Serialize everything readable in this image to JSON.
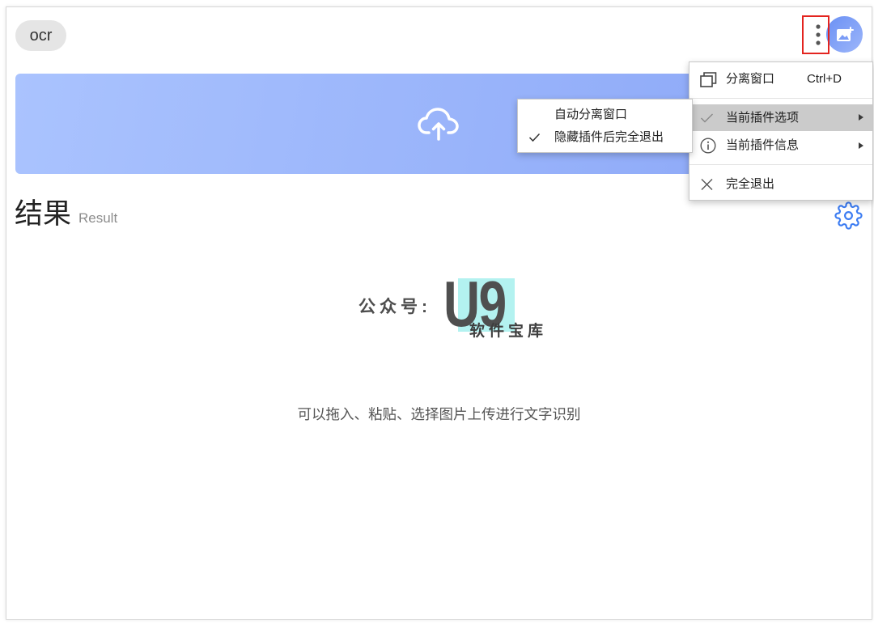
{
  "window": {
    "plugin_tag": "ocr"
  },
  "header": {
    "more_icon": "more-vertical-icon",
    "avatar_icon": "image-icon"
  },
  "upload": {
    "icon": "cloud-upload-icon"
  },
  "result": {
    "title": "结果",
    "subtitle": "Result",
    "settings_icon": "gear-icon",
    "placeholder": "可以拖入、粘贴、选择图片上传进行文字识别"
  },
  "watermark": {
    "prefix": "公众号:",
    "brand": "U9",
    "tagline": "软件宝库"
  },
  "context_menu": {
    "items": [
      {
        "label": "分离窗口",
        "shortcut": "Ctrl+D",
        "icon": "detach-window-icon"
      },
      {
        "label": "当前插件选项",
        "icon": "check-icon",
        "submenu": true,
        "highlighted": true
      },
      {
        "label": "当前插件信息",
        "icon": "info-icon",
        "submenu": true,
        "highlighted": false
      },
      {
        "label": "完全退出",
        "icon": "close-icon"
      }
    ]
  },
  "submenu": {
    "items": [
      {
        "label": "自动分离窗口",
        "checked": false
      },
      {
        "label": "隐藏插件后完全退出",
        "checked": true
      }
    ]
  },
  "colors": {
    "accent": "#3c7cf2",
    "upload-start": "#aac3fe",
    "upload-end": "#8aa6f7",
    "highlight": "#cbcbcb",
    "annotation": "#e3241f",
    "watermark-bg": "#b3f2f0"
  }
}
